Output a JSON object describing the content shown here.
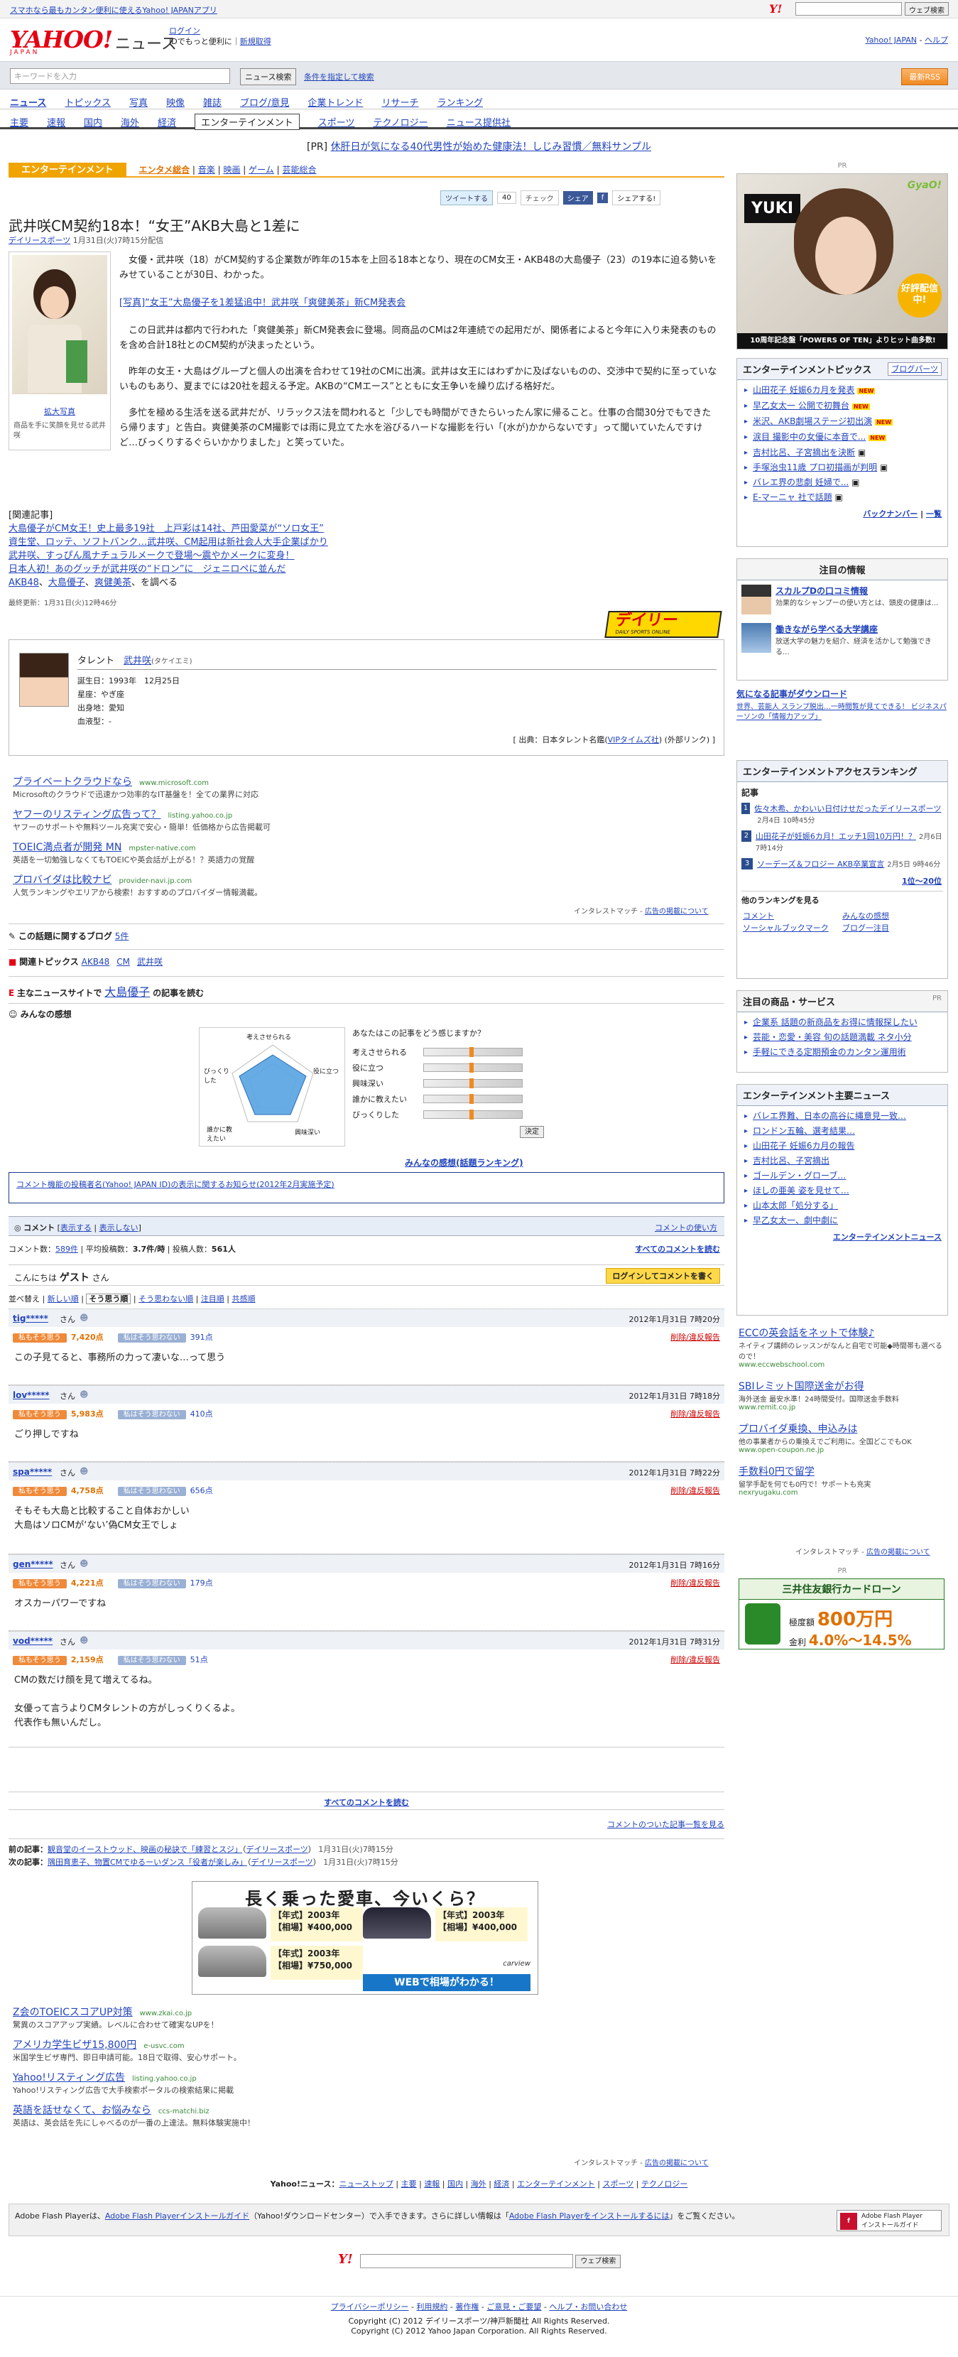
{
  "topbar": {
    "left_link": "スマホなら最もカンタン便利に使えるYahoo! JAPANアプリ",
    "search_button": "ウェブ検索"
  },
  "header": {
    "logo": "YAHOO!",
    "logo_sub": "JAPAN",
    "section": "ニュース",
    "login": "ログイン",
    "login_note": "IDでもっと便利に",
    "register": "新規取得",
    "top_link": "Yahoo! JAPAN",
    "help": "ヘルプ"
  },
  "search": {
    "placeholder": "キーワードを入力",
    "button": "ニュース検索",
    "option": "条件を指定して検索",
    "rss": "最新RSS"
  },
  "nav1": [
    "ニュース",
    "トピックス",
    "写真",
    "映像",
    "雑誌",
    "ブログ/意見",
    "企業トレンド",
    "リサーチ",
    "ランキング"
  ],
  "nav2": [
    "主要",
    "速報",
    "国内",
    "海外",
    "経済",
    "エンターテインメント",
    "スポーツ",
    "テクノロジー",
    "ニュース提供社"
  ],
  "pr_line": {
    "tag": "[PR]",
    "text": "休肝日が気になる40代男性が始めた健康法！しじみ習慣／無料サンプル"
  },
  "category": {
    "label": "エンターテインメント",
    "tabs": [
      "エンタメ総合",
      "音楽",
      "映画",
      "ゲーム",
      "芸能総合"
    ]
  },
  "share": {
    "tweet": "ツイートする",
    "tweet_count": "40",
    "check": "チェック",
    "share": "シェア",
    "share2": "シェアする!"
  },
  "article": {
    "title": "武井咲CM契約18本！“女王”AKB大島と1差に",
    "source": "デイリースポーツ",
    "date": "1月31日(火)7時15分配信",
    "photo_label": "拡大写真",
    "photo_caption": "商品を手に笑顔を見せる武井咲",
    "p1": "女優・武井咲（18）がCM契約する企業数が昨年の15本を上回る18本となり、現在のCM女王・AKB48の大島優子（23）の19本に迫る勢いをみせていることが30日、わかった。",
    "photo_link": "[写真]“女王”大島優子を1差猛追中！武井咲「爽健美茶」新CM発表会",
    "p2": "この日武井は都内で行われた「爽健美茶」新CM発表会に登場。同商品のCMは2年連続での起用だが、関係者によると今年に入り未発表のものを含め合計18社とのCM契約が決まったという。",
    "p3": "昨年の女王・大島はグループと個人の出演を合わせて19社のCMに出演。武井は女王にはわずかに及ばないものの、交渉中で契約に至っていないものもあり、夏までには20社を超える予定。AKBの“CMエース”とともに女王争いを繰り広げる格好だ。",
    "p4": "多忙を極める生活を送る武井だが、リラックス法を問われると「少しでも時間ができたらいったん家に帰ること。仕事の合間30分でもできたら帰ります」と告白。爽健美茶のCM撮影では雨に見立てた水を浴びるハードな撮影を行い「(水が)かからないです」って聞いていたんですけど…びっくりするぐらいかかりました」と笑っていた。",
    "related_header": "[関連記事]",
    "related": [
      "大島優子がCM女王！史上最多19社　上戸彩は14社、芦田愛菜が“ソロ女王”",
      "資生堂、ロッテ、ソフトバンク…武井咲、CM起用は新社会人大手企業ばかり",
      "武井咲、すっぴん風ナチュラルメークで登場〜震やかメークに変身！",
      "日本人初！あのグッチが武井咲の“ドロン”に　ジェニロペに並んだ"
    ],
    "related_tags": [
      "AKB48",
      "大島優子",
      "爽健美茶"
    ],
    "related_tags_suffix": "を調べる",
    "updated": "最終更新：1月31日(火)12時46分",
    "source_logo": "デイリー",
    "source_logo_sub": "DAILY SPORTS ONLINE"
  },
  "talent": {
    "label": "タレント",
    "name": "武井咲",
    "kana": "(タケイエミ)",
    "birth": "誕生日：1993年　12月25日",
    "sign": "星座：やぎ座",
    "place": "出身地：愛知",
    "blood": "血液型：-",
    "credit_pre": "[ 出典：日本タレント名鑑(",
    "credit_link": "VIPタイムズ社",
    "credit_post": ") (外部リンク) ]"
  },
  "ads1": [
    {
      "title": "プライベートクラウドなら",
      "url": "www.microsoft.com",
      "desc": "Microsoftのクラウドで迅速かつ効率的なIT基盤を！全ての業界に対応"
    },
    {
      "title": "ヤフーのリスティング広告って？",
      "url": "listing.yahoo.co.jp",
      "desc": "ヤフーのサポートや無料ツール充実で安心・簡単！低価格から広告掲載可"
    },
    {
      "title": "TOEIC満点者が開発 MN",
      "url": "mpster-native.com",
      "desc": "英語を一切勉強しなくてもTOEICや英会話が上がる！？英語力の覚醒"
    },
    {
      "title": "プロバイダは比較ナビ",
      "url": "provider-navi.jp.com",
      "desc": "人気ランキングやエリアから検索！おすすめのプロバイダー情報満載。"
    }
  ],
  "ads1_footer": {
    "brand": "インタレストマッチ",
    "sep": " - ",
    "link": "広告の掲載について"
  },
  "blog": {
    "label": "この話題に関するブログ",
    "count": "5件"
  },
  "topics": {
    "label": "関連トピックス",
    "items": [
      "AKB48",
      "CM",
      "武井咲"
    ]
  },
  "other_news": {
    "pre": "主なニュースサイトで",
    "name": "大島優子",
    "post": "の記事を読む"
  },
  "minna": {
    "label": "みんなの感想",
    "question": "あなたはこの記事をどう感じますか？",
    "axes": [
      "考えさせられる",
      "役に立つ",
      "興味深い",
      "誰かに教えたい",
      "びっくりした"
    ],
    "radar_labels": [
      "考えさせられる",
      "役に立つ",
      "興味深い",
      "誰かに教えたい",
      "びっくりした"
    ],
    "decide": "決定",
    "ranking_link": "みんなの感想(話題ランキング)",
    "notice": "コメント機能の投稿者名(Yahoo! JAPAN ID)の表示に関するお知らせ(2012年2月実施予定)"
  },
  "comments": {
    "header": "コメント",
    "show": "表示する",
    "hide": "表示しない",
    "usage": "コメントの使い方",
    "count_label": "コメント数：",
    "count": "589件",
    "avg_label": "平均投稿数：",
    "avg": "3.7件/時",
    "posters_label": "投稿人数：",
    "posters": "561人",
    "all_link": "すべてのコメントを読む",
    "hello": "こんにちは",
    "guest": "ゲスト",
    "san": "さん",
    "login_btn": "ログインしてコメントを書く",
    "sort_label": "並べ替え",
    "sort": [
      "新しい順",
      "そう思う順",
      "そう思わない順",
      "注目順",
      "共感順"
    ],
    "good_label": "私もそう思う",
    "bad_label": "私はそう思わない",
    "report": "削除/違反報告",
    "items": [
      {
        "user": "tig*****",
        "date": "2012年1月31日 7時20分",
        "good": "7,420点",
        "bad": "391点",
        "text": [
          "この子見てると、事務所の力って凄いな…って思う"
        ]
      },
      {
        "user": "lov*****",
        "date": "2012年1月31日 7時18分",
        "good": "5,983点",
        "bad": "410点",
        "text": [
          "ごり押しですね"
        ]
      },
      {
        "user": "spa*****",
        "date": "2012年1月31日 7時22分",
        "good": "4,758点",
        "bad": "656点",
        "text": [
          "そもそも大島と比較すること自体おかしい",
          "大島はソロCMが‘ない’偽CM女王でしょ"
        ]
      },
      {
        "user": "gen*****",
        "date": "2012年1月31日 7時16分",
        "good": "4,221点",
        "bad": "179点",
        "text": [
          "オスカーパワーですね"
        ]
      },
      {
        "user": "vod*****",
        "date": "2012年1月31日 7時31分",
        "good": "2,159点",
        "bad": "51点",
        "text": [
          "CMの数だけ顔を見て増えてるね。",
          "",
          "女優って言うよりCMタレントの方がしっくりくるよ。",
          "代表作も無いんだし。"
        ]
      }
    ],
    "read_all": "すべてのコメントを読む",
    "ranking": "コメントのついた記事一覧を見る"
  },
  "prevnext": {
    "prev_label": "前の記事：",
    "prev": "観音堂のイーストウッド、映画の秘訣で「練習とスジ」",
    "prev_src": "デイリースポーツ",
    "prev_date": "1月31日(火)7時15分",
    "next_label": "次の記事：",
    "next": "隅田育恵子、物置CMでゆるーいダンス「役者が楽しみ」",
    "next_src": "デイリースポーツ",
    "next_date": "1月31日(火)7時15分"
  },
  "car_ad": {
    "headline": "長く乗った愛車、今いくら？",
    "year_label": "【年式】",
    "price_label": "【相場】",
    "cars": [
      {
        "year": "2003年",
        "price": "¥400,000"
      },
      {
        "year": "2003年",
        "price": "¥400,000"
      },
      {
        "year": "2003年",
        "price": "¥750,000"
      }
    ],
    "cta": "WEBで相場がわかる！",
    "brand": "carview"
  },
  "ads2": [
    {
      "title": "Z会のTOEICスコアUP対策",
      "url": "www.zkai.co.jp",
      "desc": "驚異のスコアアップ実績。レベルに合わせて確実なUPを！"
    },
    {
      "title": "アメリカ学生ビザ15,800円",
      "url": "e-usvc.com",
      "desc": "米国学生ビザ専門、即日申請可能。18日で取得、安心サポート。"
    },
    {
      "title": "Yahoo!リスティング広告",
      "url": "listing.yahoo.co.jp",
      "desc": "Yahoo!リスティング広告で大手検索ポータルの検索結果に掲載"
    },
    {
      "title": "英語を話せなくて、お悩みなら",
      "url": "ccs-matchi.biz",
      "desc": "英語は、英会話を先にしゃべるのが一番の上達法。無料体験実施中！"
    }
  ],
  "ads2_footer": {
    "brand": "インタレストマッチ",
    "sep": " - ",
    "link": "広告の掲載について"
  },
  "footer_nav": {
    "label": "Yahoo!ニュース：",
    "items": [
      "ニューストップ",
      "主要",
      "速報",
      "国内",
      "海外",
      "経済",
      "エンターテインメント",
      "スポーツ",
      "テクノロジー"
    ]
  },
  "flash": {
    "text1": "Adobe Flash Playerは、",
    "link1": "Adobe Flash Playerインストールガイド",
    "text2": "（Yahoo!ダウンロードセンター）で入手できます。さらに詳しい情報は「",
    "link2": "Adobe Flash Playerをインストールするには",
    "text3": "」をご覧ください。",
    "badge": "Adobe Flash Player",
    "badge_sub": "インストールガイド"
  },
  "bottom_search": {
    "button": "ウェブ検索"
  },
  "footer": {
    "links": [
      "プライバシーポリシー",
      "利用規約",
      "著作権",
      "ご意見・ご要望",
      "ヘルプ・お問い合わせ"
    ],
    "copy1": "Copyright (C) 2012 デイリースポーツ/神戸新聞社 All Rights Reserved.",
    "copy2": "Copyright (C) 2012 Yahoo Japan Corporation. All Rights Reserved."
  },
  "sidebar": {
    "pr": "PR",
    "banner_name": "YUKI",
    "banner_brand": "GyaO!",
    "banner_badge": "好評配信中!",
    "banner_bottom": "10周年記念盤「POWERS OF TEN」よりヒット曲多数!",
    "ent_topics_title": "エンターテインメントピックス",
    "ent_topics_link": "ブログパーツ",
    "ent_topics": [
      "山田花子 妊娠6カ月を発表",
      "早乙女太一 公開で初舞台",
      "米沢、AKB劇場ステージ初出演",
      "涙目 撮影中の女優に本音で...",
      "吉村比呂、子宮摘出を決断",
      "手塚治虫11歳 プロ初描画が判明",
      "バレエ界の悲劇 妊婦で...",
      "E-マーニャ 社で話題"
    ],
    "ent_topics_new": "NEW",
    "backnumber": "バックナンバー",
    "list_link": "一覧",
    "attention_title": "注目の情報",
    "att1_title": "スカルプDの口コミ情報",
    "att1_desc": "効果的なシャンプーの使い方とは、頭皮の健康は...",
    "att2_title": "働きながら学べる大学講座",
    "att2_desc": "放送大学の魅力を紹介、経済を活かして勉強できる...",
    "download_title": "気になる記事がダウンロード",
    "download_desc": "世界、芸能人 スランプ脱出…一時閲覧が見てできる！ ビジネスパーソンの「情報力アップ」",
    "access_title": "エンターテインメントアクセスランキング",
    "access_sub": "記事",
    "access": [
      {
        "t": "佐々木希、かわいい日付けせだったデイリースポーツ",
        "d": "2月4日 10時45分"
      },
      {
        "t": "山田花子が妊娠6カ月！エッチ1回10万円！？",
        "d": "2月6日 7時14分"
      },
      {
        "t": "ソーデーズ＆フロジー AKB卒業宣言",
        "d": "2月5日 9時46分"
      }
    ],
    "access_range": "1位〜20位",
    "other_ranking": "他のランキングを見る",
    "rank_links": [
      "コメント",
      "みんなの感想",
      "ソーシャルブックマーク",
      "ブログ一注目"
    ],
    "service_title": "注目の商品・サービス",
    "service_pr": "PR",
    "services": [
      "企業系 話題の新商品をお得に情報探したい",
      "芸能・恋愛・美容 旬の話題満載 ネタ小分",
      "手軽にできる定期預金のカンタン運用術"
    ],
    "main_news_title": "エンターテインメント主要ニュース",
    "main_news": [
      "バレエ界難、日本の高谷に縄意見一致…",
      "ロンドン五輪、選考結果…",
      "山田花子 妊娠6カ月の報告",
      "吉村比呂、子宮摘出",
      "ゴールデン・グローブ…",
      "ほしの亜美 姿を見せて…",
      "山本太郎「処分する」",
      "早乙女太一、劇中劇に"
    ],
    "main_news_more": "エンターテインメントニュース",
    "ads": [
      {
        "t": "ECCの英会話をネットで体験♪",
        "d": "ネイティブ講師のレッスンがなんと自宅で可能◆時間帯も選べるので！",
        "u": "www.eccwebschool.com"
      },
      {
        "t": "SBIレミット国際送金がお得",
        "d": "海外送金 最安水準！24時間受付。国際送金手数料",
        "u": "www.remit.co.jp"
      },
      {
        "t": "プロバイダ乗換、申込みは",
        "d": "他の事業者からの乗換えでご利用に。全国どこでもOK",
        "u": "www.open-coupon.ne.jp"
      },
      {
        "t": "手数料0円で留学",
        "d": "留学手配を何でも0円で！サポートも充実",
        "u": "nexryugaku.com"
      }
    ],
    "ads_footer": {
      "brand": "インタレストマッチ",
      "sep": " - ",
      "link": "広告の掲載について"
    },
    "bank_pr": "PR",
    "bank_name": "三井住友銀行カードローン",
    "bank_limit_label": "極度額",
    "bank_limit": "800万円",
    "bank_rate_label": "金利",
    "bank_rate": "4.0%〜14.5%"
  }
}
